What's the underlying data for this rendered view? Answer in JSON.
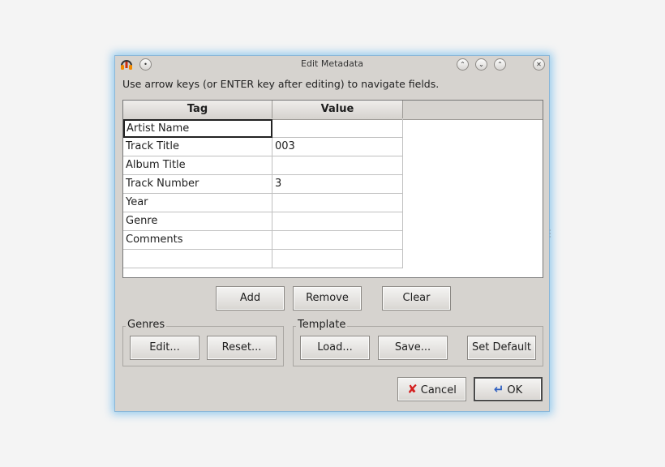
{
  "window": {
    "title": "Edit Metadata",
    "accent_color": "#8ab6d8",
    "buttons": [
      "keep-above-icon",
      "minimize-icon",
      "maximize-icon",
      "close-icon"
    ]
  },
  "hint": "Use arrow keys (or ENTER key after editing) to navigate fields.",
  "table": {
    "headers": [
      "Tag",
      "Value"
    ],
    "rows": [
      {
        "tag": "Artist Name",
        "value": ""
      },
      {
        "tag": "Track Title",
        "value": "003"
      },
      {
        "tag": "Album Title",
        "value": ""
      },
      {
        "tag": "Track Number",
        "value": "3"
      },
      {
        "tag": "Year",
        "value": ""
      },
      {
        "tag": "Genre",
        "value": ""
      },
      {
        "tag": "Comments",
        "value": ""
      },
      {
        "tag": "",
        "value": ""
      }
    ]
  },
  "actions": {
    "add": "Add",
    "remove": "Remove",
    "clear": "Clear"
  },
  "genres": {
    "label": "Genres",
    "edit": "Edit...",
    "reset": "Reset..."
  },
  "template": {
    "label": "Template",
    "load": "Load...",
    "save": "Save...",
    "set_default": "Set Default"
  },
  "footer": {
    "cancel": "Cancel",
    "ok": "OK"
  }
}
